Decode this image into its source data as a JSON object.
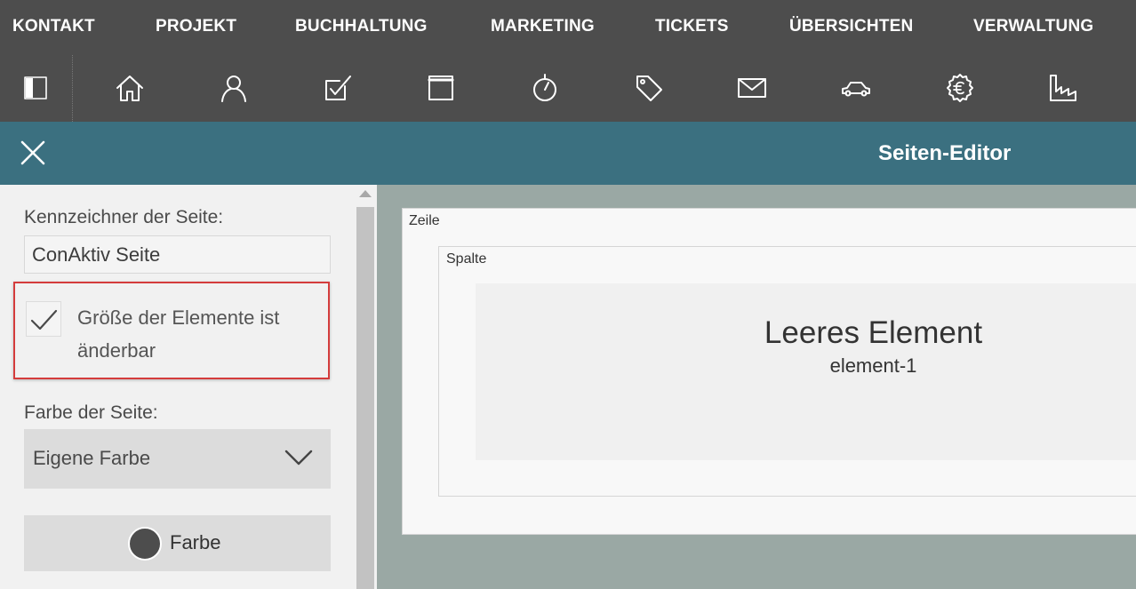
{
  "topnav": {
    "items": [
      "KONTAKT",
      "PROJEKT",
      "BUCHHALTUNG",
      "MARKETING",
      "TICKETS",
      "ÜBERSICHTEN",
      "VERWALTUNG"
    ]
  },
  "iconbar": {
    "icons": [
      "sidebar-toggle-icon",
      "home-icon",
      "user-icon",
      "task-icon",
      "window-icon",
      "stopwatch-icon",
      "tag-icon",
      "mail-icon",
      "car-icon",
      "euro-icon",
      "factory-icon"
    ]
  },
  "editor": {
    "title": "Seiten-Editor"
  },
  "panel": {
    "identifier_label": "Kennzeichner der Seite:",
    "identifier_value": "ConAktiv Seite",
    "resizable_label": "Größe der Elemente ist änderbar",
    "resizable_checked": true,
    "color_label": "Farbe der Seite:",
    "color_select_value": "Eigene Farbe",
    "color_button_label": "Farbe",
    "color_swatch": "#4d4d4d"
  },
  "canvas": {
    "row_label": "Zeile",
    "column_label": "Spalte",
    "element_title": "Leeres Element",
    "element_id": "element-1"
  },
  "colors": {
    "topbar": "#4d4d4d",
    "editorbar": "#3b7080",
    "highlight_border": "#d43c3c",
    "canvas_bg": "#9aa8a4"
  }
}
